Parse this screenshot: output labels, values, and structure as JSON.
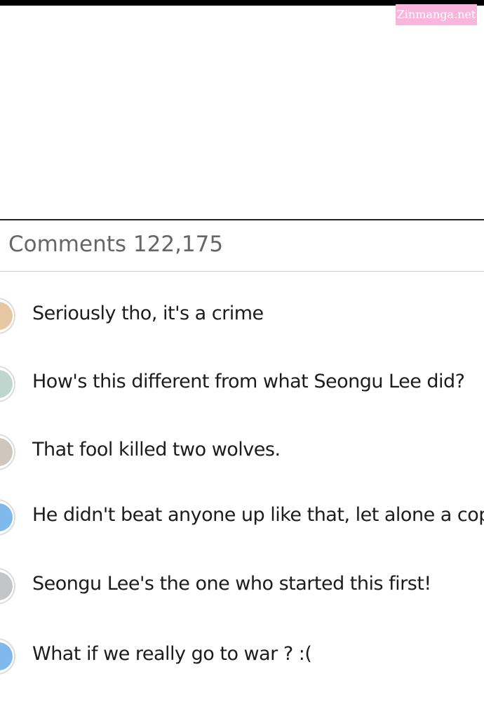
{
  "watermark": {
    "text": "Zinmanga.net",
    "color": "#f8b6dc"
  },
  "comments": {
    "label": "Comments",
    "count": "122,175",
    "items": [
      {
        "text": "Seriously tho, it's a crime",
        "avatar_color": "#e6c7a3"
      },
      {
        "text": "How's this different from what Seongu Lee did?",
        "avatar_color": "#bfd6cf"
      },
      {
        "text": "That fool killed two wolves.",
        "avatar_color": "#cfc6bd"
      },
      {
        "text": "He didn't beat anyone up like that, let alone a cop",
        "avatar_color": "#7fb8ea"
      },
      {
        "text": "Seongu Lee's the one who started this first!",
        "avatar_color": "#c3c5c9"
      },
      {
        "text": "What if we really go to war ? :(",
        "avatar_color": "#7fb8ea"
      }
    ]
  }
}
